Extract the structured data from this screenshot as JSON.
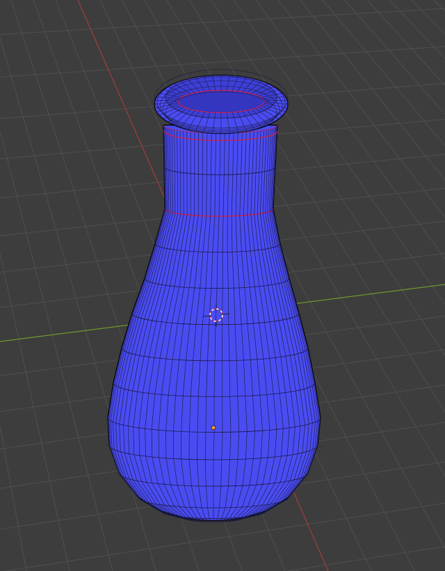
{
  "viewport": {
    "background_color": "#3d3d3d",
    "grid_color": "#4f4f4f",
    "x_axis_color": "#a33c3c",
    "y_axis_color": "#6f9a2a"
  },
  "object": {
    "name_icon": "flask-mesh",
    "face_color": "#4a4cf2",
    "wire_color": "#1a1a40",
    "seam_color": "#d0204a",
    "origin_color": "#ffa030"
  },
  "cursor": {
    "icon": "3d-cursor-icon"
  }
}
